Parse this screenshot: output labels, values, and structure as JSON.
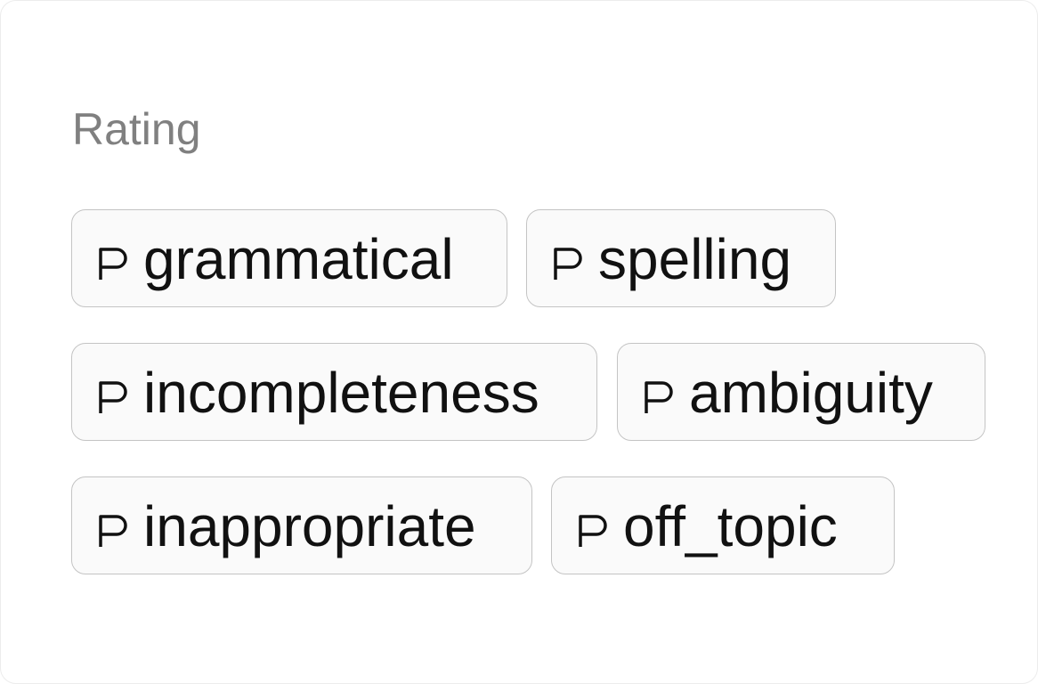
{
  "section": {
    "label": "Rating"
  },
  "tags": [
    {
      "label": "grammatical",
      "icon": "flag-icon"
    },
    {
      "label": "spelling",
      "icon": "flag-icon"
    },
    {
      "label": "incompleteness",
      "icon": "flag-icon"
    },
    {
      "label": "ambiguity",
      "icon": "flag-icon"
    },
    {
      "label": "inappropriate",
      "icon": "flag-icon"
    },
    {
      "label": "off_topic",
      "icon": "flag-icon"
    }
  ],
  "colors": {
    "chip_border": "#c4c4c4",
    "chip_background": "#fafafa",
    "label_text": "#111111",
    "section_label": "#808080"
  }
}
